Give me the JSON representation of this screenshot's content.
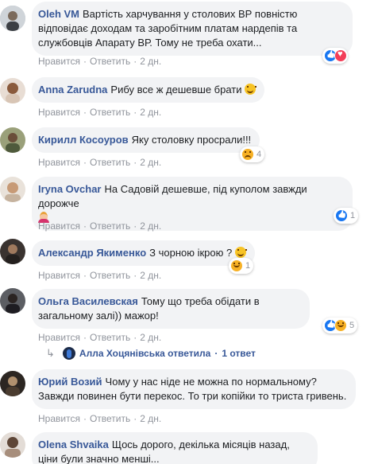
{
  "actions": {
    "like": "Нравится",
    "reply": "Ответить",
    "time": "2 дн."
  },
  "comments": [
    {
      "author": "Oleh VM",
      "text": "Вартість харчування у столових ВР повністю відповідає доходам та заробітним платам нардепів та службовців Апарату ВР. Тому не треба охати...",
      "reactions": [
        "like",
        "love"
      ],
      "reaction_count": ""
    },
    {
      "author": "Anna Zarudna",
      "text": "Рибу все ж дешевше брати",
      "emoji": "smile",
      "reactions": [],
      "reaction_count": ""
    },
    {
      "author": "Кирилл Косоуров",
      "text": "Яку столовку просрали!!!",
      "reactions": [
        "sad"
      ],
      "reaction_count": "4"
    },
    {
      "author": "Iryna Ovchar",
      "text": "На Садовій дешевше, під куполом завжди дорожче",
      "emoji": "woman",
      "reactions": [
        "like"
      ],
      "reaction_count": "1"
    },
    {
      "author": "Александр Якименко",
      "text": "З чорною ікрою ?",
      "emoji": "smile",
      "reactions": [
        "haha"
      ],
      "reaction_count": "1"
    },
    {
      "author": "Ольга Василевская",
      "text": "Тому що треба обідати в загальному залі)) мажор!",
      "reactions": [
        "like",
        "haha"
      ],
      "reaction_count": "5"
    },
    {
      "author": "Юрий Возий",
      "text": "Чому у нас ніде не можна по нормальному? Завжди повинен бути перекос. То три копійки то триста гривень.",
      "reactions": [],
      "reaction_count": ""
    },
    {
      "author": "Olena Shvaika",
      "text": "Щось дорого, декілька місяців назад, ціни були значно менші...",
      "reactions": [],
      "reaction_count": ""
    }
  ],
  "reply_summary": {
    "name": "Алла Хоцянівська",
    "action": "ответила",
    "count": "1 ответ"
  },
  "colors": {
    "link": "#385898",
    "bubble": "#f2f3f5",
    "meta": "#90949c",
    "like": "#1877f2",
    "love": "#f33e58",
    "haha": "#f7b125"
  }
}
